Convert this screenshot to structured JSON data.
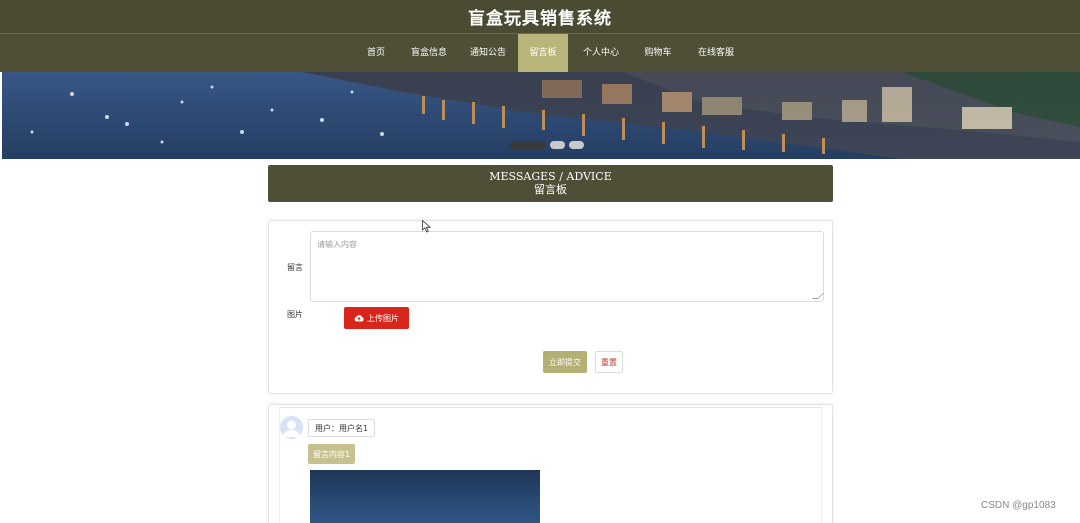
{
  "header": {
    "title": "盲盒玩具销售系统"
  },
  "nav": {
    "items": [
      {
        "label": "首页"
      },
      {
        "label": "盲盒信息"
      },
      {
        "label": "通知公告"
      },
      {
        "label": "留言板",
        "active": true
      },
      {
        "label": "个人中心"
      },
      {
        "label": "购物车"
      },
      {
        "label": "在线客服"
      }
    ],
    "active_color": "#b9b57a",
    "bar_color": "#4f4e36"
  },
  "banner": {
    "slides": 3,
    "active_slide": 1
  },
  "section": {
    "title_en": "MESSAGES / ADVICE",
    "title_cn": "留言板"
  },
  "form": {
    "message_label": "留言",
    "message_placeholder": "请输入内容",
    "image_label": "图片",
    "upload_label": "上传图片",
    "submit_label": "立即提交",
    "reset_label": "重置"
  },
  "messages": [
    {
      "user": "用户：用户名1",
      "content": "留言内容1"
    }
  ],
  "watermark": "CSDN @gp1083",
  "colors": {
    "accent": "#b4af73",
    "upload": "#d9261c",
    "header": "#4b4a33"
  },
  "icons": {
    "upload": "cloud-upload-icon",
    "avatar": "user-avatar-icon"
  }
}
